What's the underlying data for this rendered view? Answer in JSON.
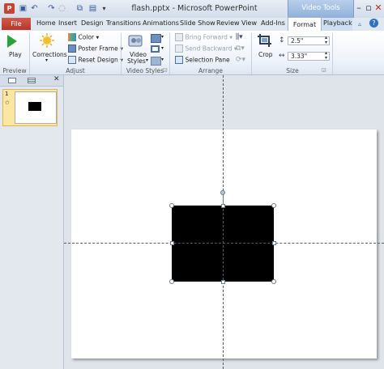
{
  "window": {
    "title": "flash.pptx - Microsoft PowerPoint",
    "context_tab_group": "Video Tools"
  },
  "tabs": {
    "file": "File",
    "items": [
      "Home",
      "Insert",
      "Design",
      "Transitions",
      "Animations",
      "Slide Show",
      "Review",
      "View",
      "Add-Ins"
    ],
    "format": "Format",
    "playback": "Playback"
  },
  "ribbon": {
    "preview": {
      "play": "Play",
      "label": "Preview"
    },
    "adjust": {
      "corrections": "Corrections",
      "color": "Color",
      "poster_frame": "Poster Frame",
      "reset_design": "Reset Design",
      "label": "Adjust"
    },
    "video_styles": {
      "styles_line1": "Video",
      "styles_line2": "Styles",
      "label": "Video Styles"
    },
    "arrange": {
      "bring_forward": "Bring Forward",
      "send_backward": "Send Backward",
      "selection_pane": "Selection Pane",
      "label": "Arrange"
    },
    "size": {
      "crop": "Crop",
      "height": "2.5\"",
      "width": "3.33\"",
      "label": "Size"
    }
  },
  "slides": {
    "number": "1"
  },
  "colors": {
    "file_tab": "#c0392b",
    "context_tab": "#9fbde4",
    "thumb_selected": "#fbe6a2"
  },
  "icons": [
    "save-icon",
    "undo-icon",
    "redo-icon",
    "play-icon",
    "corrections-icon",
    "color-icon",
    "poster-frame-icon",
    "reset-design-icon",
    "video-styles-icon",
    "crop-icon",
    "minimize-icon",
    "maximize-icon",
    "close-icon",
    "help-icon"
  ]
}
